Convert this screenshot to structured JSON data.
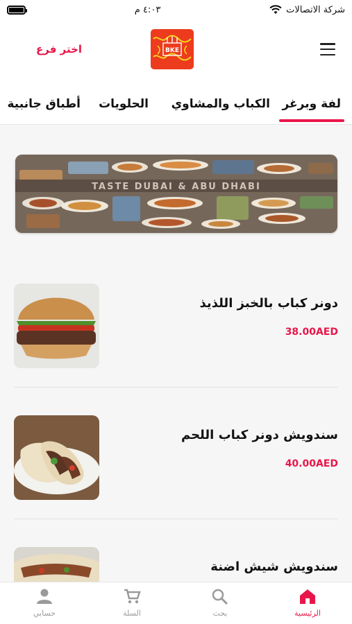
{
  "status_bar": {
    "carrier": "شركة الاتصالات",
    "time": "٤:٠٣ م"
  },
  "header": {
    "branch_label": "اختر فرع",
    "logo_text": "BKE"
  },
  "tabs": [
    {
      "label": "لفة وبرغر",
      "active": true
    },
    {
      "label": "الكباب والمشاوي",
      "active": false
    },
    {
      "label": "الحلويات",
      "active": false
    },
    {
      "label": "أطباق جانبية",
      "active": false
    }
  ],
  "banner": {
    "text": "TASTE DUBAI & ABU DHABI"
  },
  "products": [
    {
      "name": "دونر كباب بالخبز اللذيذ",
      "price": "38.00AED"
    },
    {
      "name": "سندويش دونر كباب اللحم",
      "price": "40.00AED"
    },
    {
      "name": "سندويش شيش اضنة",
      "price": ""
    }
  ],
  "bottom_nav": [
    {
      "label": "الرئيسية",
      "icon": "home-icon",
      "active": true
    },
    {
      "label": "بحث",
      "icon": "search-icon",
      "active": false
    },
    {
      "label": "السلة",
      "icon": "cart-icon",
      "active": false
    },
    {
      "label": "حسابي",
      "icon": "account-icon",
      "active": false
    }
  ],
  "colors": {
    "accent": "#e8174a",
    "logo_background": "#ec3b1d",
    "logo_accent": "#f4d21f"
  }
}
